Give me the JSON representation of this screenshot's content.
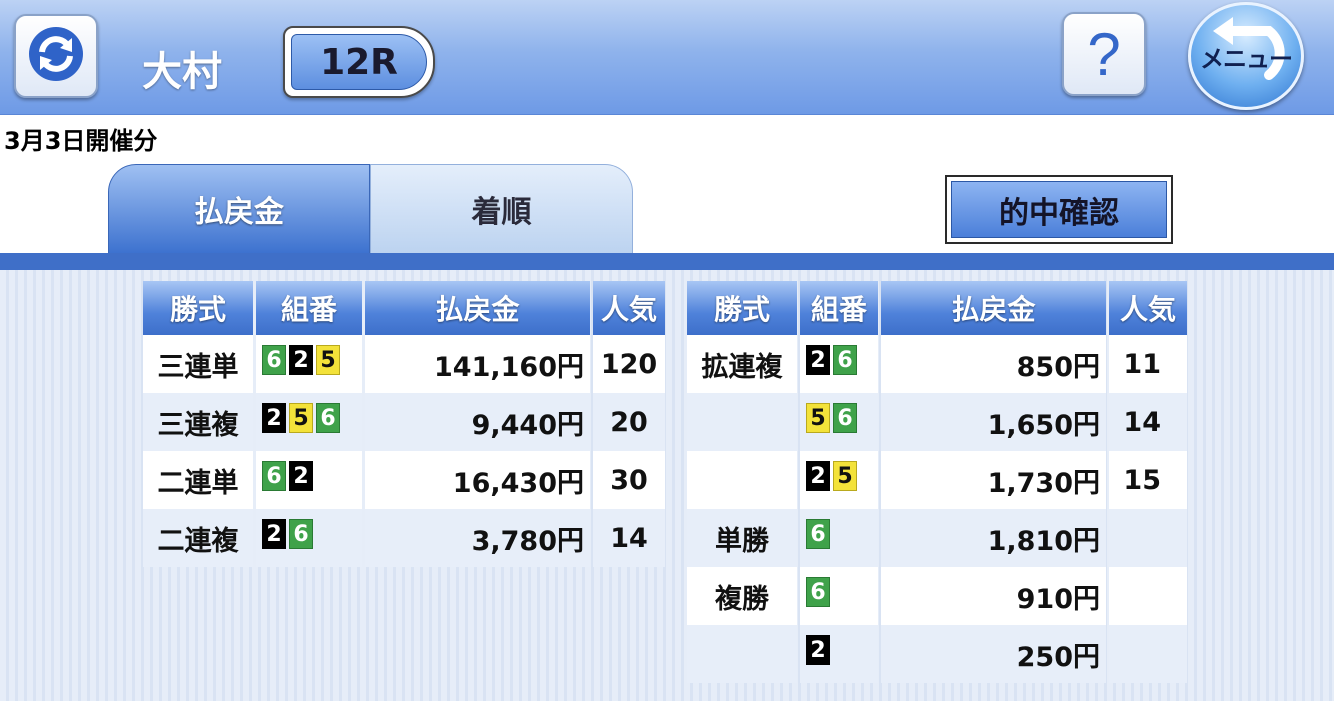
{
  "header": {
    "venue": "大村",
    "race": "12R",
    "help_label": "?",
    "menu_label": "メニュー",
    "refresh_icon": "refresh-icon",
    "back_icon": "back-arrow-icon"
  },
  "date_label": "3月3日開催分",
  "tabs": [
    {
      "label": "払戻金",
      "active": true
    },
    {
      "label": "着順",
      "active": false
    }
  ],
  "confirm_button": "的中確認",
  "table_headers": {
    "bet_type": "勝式",
    "combination": "組番",
    "payout": "払戻金",
    "popularity": "人気"
  },
  "left_rows": [
    {
      "type": "三連単",
      "combo": [
        "6",
        "2",
        "5"
      ],
      "payout": "141,160円",
      "popularity": "120"
    },
    {
      "type": "三連複",
      "combo": [
        "2",
        "5",
        "6"
      ],
      "payout": "9,440円",
      "popularity": "20"
    },
    {
      "type": "二連単",
      "combo": [
        "6",
        "2"
      ],
      "payout": "16,430円",
      "popularity": "30"
    },
    {
      "type": "二連複",
      "combo": [
        "2",
        "6"
      ],
      "payout": "3,780円",
      "popularity": "14"
    }
  ],
  "right_rows": [
    {
      "type": "拡連複",
      "combo": [
        "2",
        "6"
      ],
      "payout": "850円",
      "popularity": "11"
    },
    {
      "type": "",
      "combo": [
        "5",
        "6"
      ],
      "payout": "1,650円",
      "popularity": "14"
    },
    {
      "type": "",
      "combo": [
        "2",
        "5"
      ],
      "payout": "1,730円",
      "popularity": "15"
    },
    {
      "type": "単勝",
      "combo": [
        "6"
      ],
      "payout": "1,810円",
      "popularity": ""
    },
    {
      "type": "複勝",
      "combo": [
        "6"
      ],
      "payout": "910円",
      "popularity": ""
    },
    {
      "type": "",
      "combo": [
        "2"
      ],
      "payout": "250円",
      "popularity": ""
    }
  ],
  "colors": {
    "boat_6": "#3fa24a",
    "boat_2": "#000000",
    "boat_5": "#f3e23a",
    "header_blue": "#3f6fc8"
  }
}
